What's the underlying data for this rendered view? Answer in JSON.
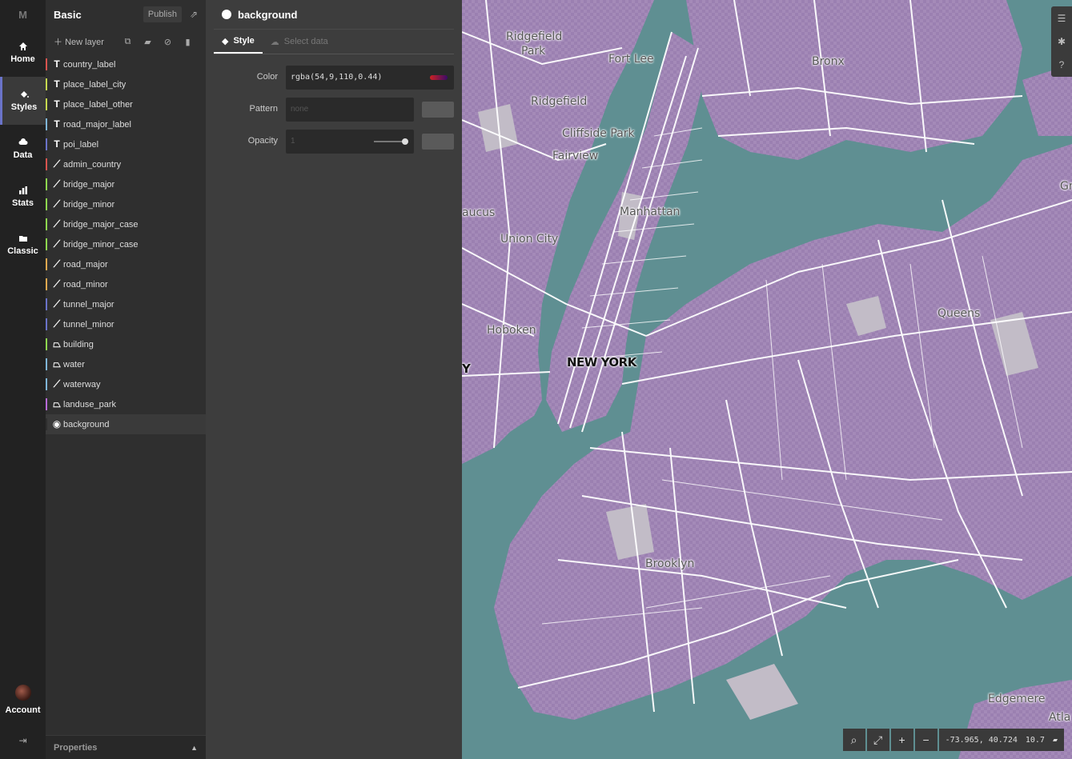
{
  "nav": {
    "logo": "M",
    "items": [
      {
        "label": "Home",
        "icon": "home-icon"
      },
      {
        "label": "Styles",
        "icon": "paint-bucket-icon"
      },
      {
        "label": "Data",
        "icon": "cloud-icon"
      },
      {
        "label": "Stats",
        "icon": "bar-chart-icon"
      },
      {
        "label": "Classic",
        "icon": "folder-icon"
      }
    ],
    "account_label": "Account",
    "logout_icon": "logout-icon"
  },
  "project": {
    "title": "Basic",
    "publish_label": "Publish",
    "new_layer_label": "New layer"
  },
  "layers": [
    {
      "name": "country_label",
      "type": "T",
      "color": "#d9534f"
    },
    {
      "name": "place_label_city",
      "type": "T",
      "color": "#c6d94f"
    },
    {
      "name": "place_label_other",
      "type": "T",
      "color": "#c6d94f"
    },
    {
      "name": "road_major_label",
      "type": "T",
      "color": "#7fb6d9"
    },
    {
      "name": "poi_label",
      "type": "T",
      "color": "#6a73c9"
    },
    {
      "name": "admin_country",
      "type": "line",
      "color": "#d9534f"
    },
    {
      "name": "bridge_major",
      "type": "line",
      "color": "#8fd94f"
    },
    {
      "name": "bridge_minor",
      "type": "line",
      "color": "#8fd94f"
    },
    {
      "name": "bridge_major_case",
      "type": "line",
      "color": "#8fd94f"
    },
    {
      "name": "bridge_minor_case",
      "type": "line",
      "color": "#8fd94f"
    },
    {
      "name": "road_major",
      "type": "line",
      "color": "#e0a84f"
    },
    {
      "name": "road_minor",
      "type": "line",
      "color": "#e0a84f"
    },
    {
      "name": "tunnel_major",
      "type": "line",
      "color": "#6a73c9"
    },
    {
      "name": "tunnel_minor",
      "type": "line",
      "color": "#6a73c9"
    },
    {
      "name": "building",
      "type": "fill",
      "color": "#8fd94f"
    },
    {
      "name": "water",
      "type": "fill",
      "color": "#7fb6d9"
    },
    {
      "name": "waterway",
      "type": "line",
      "color": "#7fb6d9"
    },
    {
      "name": "landuse_park",
      "type": "fill",
      "color": "#b86ad9"
    },
    {
      "name": "background",
      "type": "bg",
      "color": "#2f2f2f"
    }
  ],
  "properties_label": "Properties",
  "editor": {
    "layer_name": "background",
    "tab_style": "Style",
    "tab_select": "Select data",
    "color_label": "Color",
    "color_value": "rgba(54,9,110,0.44)",
    "pattern_label": "Pattern",
    "pattern_placeholder": "none",
    "opacity_label": "Opacity",
    "opacity_value": "1"
  },
  "map": {
    "labels": [
      {
        "text": "Ridgefield",
        "key": "ridgefield-park-1"
      },
      {
        "text": "Park",
        "key": "ridgefield-park-2"
      },
      {
        "text": "Fort Lee",
        "key": "fort-lee"
      },
      {
        "text": "Bronx",
        "key": "bronx"
      },
      {
        "text": "Ridgefield",
        "key": "ridgefield"
      },
      {
        "text": "Cliffside Park",
        "key": "cliffside-park"
      },
      {
        "text": "Fairview",
        "key": "fairview"
      },
      {
        "text": "Manhattan",
        "key": "manhattan"
      },
      {
        "text": "aucus",
        "key": "secaucus"
      },
      {
        "text": "Union City",
        "key": "union-city"
      },
      {
        "text": "Hoboken",
        "key": "hoboken"
      },
      {
        "text": "Queens",
        "key": "queens"
      },
      {
        "text": "NEW YORK",
        "key": "new-york"
      },
      {
        "text": "Y",
        "key": "jersey-city-y"
      },
      {
        "text": "Brooklyn",
        "key": "brooklyn"
      },
      {
        "text": "Edgemere",
        "key": "edgemere"
      },
      {
        "text": "Atla",
        "key": "atlantic"
      },
      {
        "text": "Gr",
        "key": "great-neck"
      }
    ],
    "coordinates": "-73.965, 40.724",
    "zoom": "10.7"
  }
}
